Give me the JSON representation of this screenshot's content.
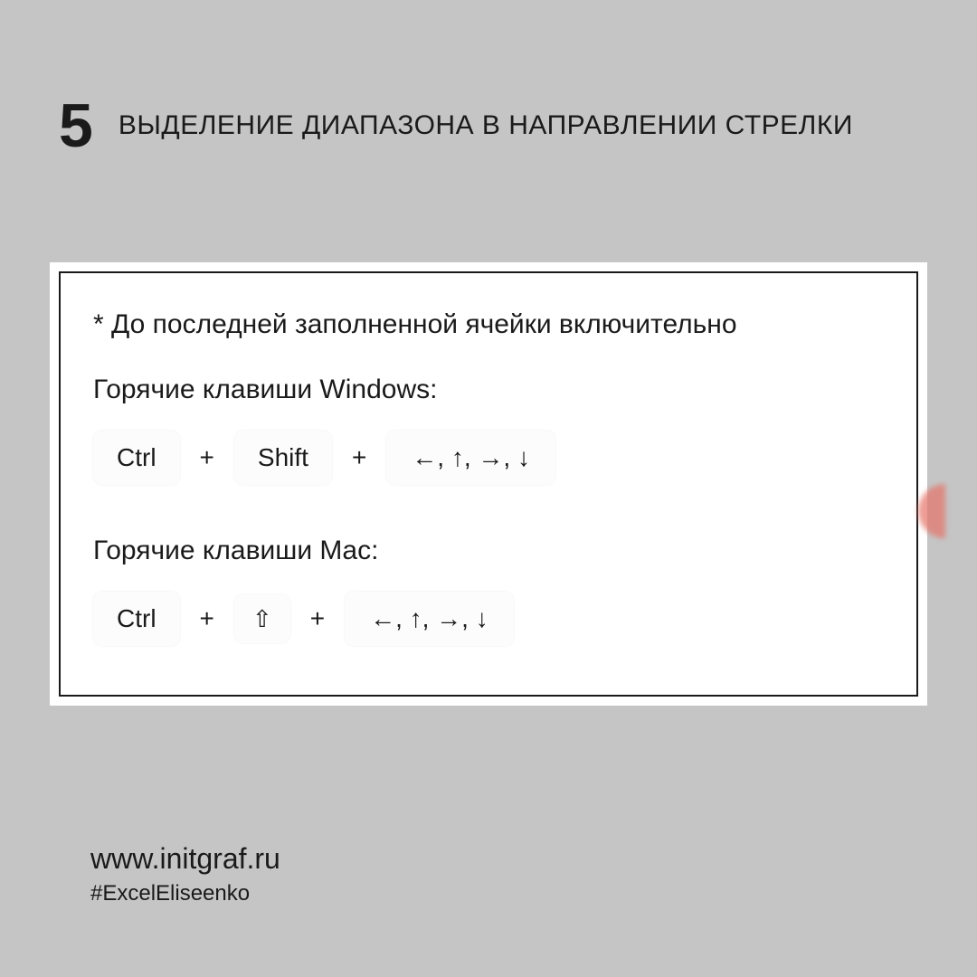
{
  "header": {
    "number": "5",
    "title": "ВЫДЕЛЕНИЕ ДИАПАЗОНА В НАПРАВЛЕНИИ СТРЕЛКИ"
  },
  "card": {
    "note": "* До последней заполненной ячейки включительно",
    "windows": {
      "label": "Горячие клавиши Windows:",
      "keys": {
        "k1": "Ctrl",
        "plus1": "+",
        "k2": "Shift",
        "plus2": "+",
        "k3": "←, ↑, →, ↓"
      }
    },
    "mac": {
      "label": "Горячие клавиши Mac:",
      "keys": {
        "k1": "Ctrl",
        "plus1": "+",
        "k2": "⇧",
        "plus2": "+",
        "k3": "←, ↑, →, ↓"
      }
    }
  },
  "footer": {
    "url": "www.initgraf.ru",
    "hashtag": "#ExcelEliseenko"
  }
}
